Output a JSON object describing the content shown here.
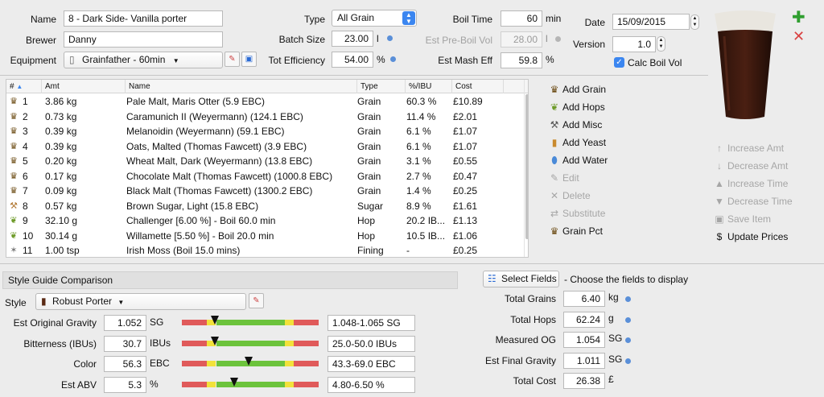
{
  "recipe": {
    "name_label": "Name",
    "name": "8 - Dark Side- Vanilla porter",
    "brewer_label": "Brewer",
    "brewer": "Danny",
    "equipment_label": "Equipment",
    "equipment": "Grainfather - 60min",
    "type_label": "Type",
    "type": "All Grain",
    "batch_label": "Batch Size",
    "batch": "23.00",
    "batch_unit": "l",
    "eff_label": "Tot Efficiency",
    "eff": "54.00",
    "eff_unit": "%",
    "boil_label": "Boil Time",
    "boil": "60",
    "boil_unit": "min",
    "preboil_label": "Est Pre-Boil Vol",
    "preboil": "28.00",
    "preboil_unit": "l",
    "mash_label": "Est Mash Eff",
    "mash": "59.8",
    "mash_unit": "%",
    "date_label": "Date",
    "date": "15/09/2015",
    "version_label": "Version",
    "version": "1.0",
    "calc_label": "Calc Boil Vol",
    "calc_checked": true
  },
  "table": {
    "headers": [
      "#",
      "Amt",
      "Name",
      "Type",
      "%/IBU",
      "Cost"
    ],
    "rows": [
      {
        "icon": "grain",
        "num": "1",
        "amt": "3.86 kg",
        "name": "Pale Malt, Maris Otter (5.9 EBC)",
        "type": "Grain",
        "pct": "60.3 %",
        "cost": "£10.89"
      },
      {
        "icon": "grain",
        "num": "2",
        "amt": "0.73 kg",
        "name": "Caramunich II (Weyermann) (124.1 EBC)",
        "type": "Grain",
        "pct": "11.4 %",
        "cost": "£2.01"
      },
      {
        "icon": "grain",
        "num": "3",
        "amt": "0.39 kg",
        "name": "Melanoidin (Weyermann) (59.1 EBC)",
        "type": "Grain",
        "pct": "6.1 %",
        "cost": "£1.07"
      },
      {
        "icon": "grain",
        "num": "4",
        "amt": "0.39 kg",
        "name": "Oats, Malted (Thomas Fawcett) (3.9 EBC)",
        "type": "Grain",
        "pct": "6.1 %",
        "cost": "£1.07"
      },
      {
        "icon": "grain",
        "num": "5",
        "amt": "0.20 kg",
        "name": "Wheat Malt, Dark (Weyermann) (13.8 EBC)",
        "type": "Grain",
        "pct": "3.1 %",
        "cost": "£0.55"
      },
      {
        "icon": "grain",
        "num": "6",
        "amt": "0.17 kg",
        "name": "Chocolate Malt (Thomas Fawcett) (1000.8 EBC)",
        "type": "Grain",
        "pct": "2.7 %",
        "cost": "£0.47"
      },
      {
        "icon": "grain",
        "num": "7",
        "amt": "0.09 kg",
        "name": "Black Malt (Thomas Fawcett) (1300.2 EBC)",
        "type": "Grain",
        "pct": "1.4 %",
        "cost": "£0.25"
      },
      {
        "icon": "sugar",
        "num": "8",
        "amt": "0.57 kg",
        "name": "Brown Sugar, Light (15.8 EBC)",
        "type": "Sugar",
        "pct": "8.9 %",
        "cost": "£1.61"
      },
      {
        "icon": "hop",
        "num": "9",
        "amt": "32.10 g",
        "name": "Challenger [6.00 %] - Boil 60.0 min",
        "type": "Hop",
        "pct": "20.2 IB...",
        "cost": "£1.13"
      },
      {
        "icon": "hop",
        "num": "10",
        "amt": "30.14 g",
        "name": "Willamette [5.50 %] - Boil 20.0 min",
        "type": "Hop",
        "pct": "10.5 IB...",
        "cost": "£1.06"
      },
      {
        "icon": "misc",
        "num": "11",
        "amt": "1.00 tsp",
        "name": "Irish Moss (Boil 15.0 mins)",
        "type": "Fining",
        "pct": "-",
        "cost": "£0.25"
      }
    ]
  },
  "actions": [
    {
      "label": "Add Grain",
      "icon": "grain-icon",
      "enabled": true
    },
    {
      "label": "Add Hops",
      "icon": "hops-icon",
      "enabled": true
    },
    {
      "label": "Add Misc",
      "icon": "misc-icon",
      "enabled": true
    },
    {
      "label": "Add Yeast",
      "icon": "yeast-icon",
      "enabled": true
    },
    {
      "label": "Add Water",
      "icon": "water-icon",
      "enabled": true
    },
    {
      "label": "Edit",
      "icon": "edit-icon",
      "enabled": false
    },
    {
      "label": "Delete",
      "icon": "delete-icon",
      "enabled": false
    },
    {
      "label": "Substitute",
      "icon": "substitute-icon",
      "enabled": false
    },
    {
      "label": "Grain Pct",
      "icon": "grain-icon",
      "enabled": true
    }
  ],
  "adjust": [
    {
      "label": "Increase Amt",
      "icon": "arrow-up-icon",
      "enabled": false
    },
    {
      "label": "Decrease Amt",
      "icon": "arrow-down-icon",
      "enabled": false
    },
    {
      "label": "Increase Time",
      "icon": "triangle-up-icon",
      "enabled": false
    },
    {
      "label": "Decrease Time",
      "icon": "triangle-down-icon",
      "enabled": false
    },
    {
      "label": "Save Item",
      "icon": "save-icon",
      "enabled": false
    },
    {
      "label": "Update Prices",
      "icon": "dollar-icon",
      "enabled": true
    }
  ],
  "style": {
    "section_title": "Style Guide Comparison",
    "style_label": "Style",
    "style_value": "Robust Porter",
    "rows": [
      {
        "label": "Est Original Gravity",
        "value": "1.052",
        "unit": "SG",
        "range": "1.048-1.065 SG",
        "marker_pct": 0.24
      },
      {
        "label": "Bitterness (IBUs)",
        "value": "30.7",
        "unit": "IBUs",
        "range": "25.0-50.0 IBUs",
        "marker_pct": 0.24
      },
      {
        "label": "Color",
        "value": "56.3",
        "unit": "EBC",
        "range": "43.3-69.0 EBC",
        "marker_pct": 0.49
      },
      {
        "label": "Est ABV",
        "value": "5.3",
        "unit": "%",
        "range": "4.80-6.50 %",
        "marker_pct": 0.38
      }
    ]
  },
  "fields": {
    "button": "Select Fields",
    "hint": "- Choose the fields to display",
    "rows": [
      {
        "label": "Total Grains",
        "value": "6.40",
        "unit": "kg",
        "dot": true
      },
      {
        "label": "Total Hops",
        "value": "62.24",
        "unit": "g",
        "dot": true
      },
      {
        "label": "Measured OG",
        "value": "1.054",
        "unit": "SG",
        "dot": true
      },
      {
        "label": "Est Final Gravity",
        "value": "1.011",
        "unit": "SG",
        "dot": true
      },
      {
        "label": "Total Cost",
        "value": "26.38",
        "unit": "£",
        "dot": false
      }
    ]
  },
  "colors": {
    "accent": "#3b86f0",
    "add": "#2f9e2f",
    "remove": "#d94141",
    "bar_red": "#e05a5a",
    "bar_yellow": "#f2e23a",
    "bar_green": "#6cc33c"
  }
}
